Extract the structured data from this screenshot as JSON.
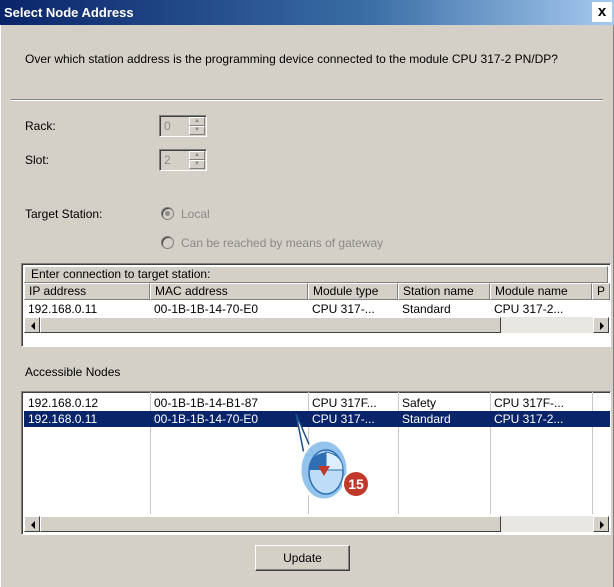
{
  "window": {
    "title": "Select Node Address",
    "close_label": "x"
  },
  "question": "Over which station address is the programming device connected to the module CPU 317-2 PN/DP?",
  "rack": {
    "label": "Rack:",
    "value": "0"
  },
  "slot": {
    "label": "Slot:",
    "value": "2"
  },
  "target_station": {
    "label": "Target Station:",
    "options": [
      "Local",
      "Can be reached by means of gateway"
    ],
    "selected": "Local"
  },
  "connection": {
    "group_label": "Enter connection to target station:",
    "columns": [
      "IP address",
      "MAC address",
      "Module type",
      "Station name",
      "Module name",
      "P"
    ],
    "row": [
      "192.168.0.11",
      "00-1B-1B-14-70-E0",
      "CPU 317-...",
      "Standard",
      "CPU 317-2..."
    ]
  },
  "accessible_nodes": {
    "label": "Accessible Nodes",
    "rows": [
      [
        "192.168.0.12",
        "00-1B-1B-14-B1-87",
        "CPU 317F...",
        "Safety",
        "CPU 317F-..."
      ],
      [
        "192.168.0.11",
        "00-1B-1B-14-70-E0",
        "CPU 317-...",
        "Standard",
        "CPU 317-2..."
      ]
    ],
    "selected_row": 1
  },
  "update_button": "Update",
  "step_badge": "15",
  "colors": {
    "selection": "#0a246a",
    "badge": "#c0392b",
    "dialog": "#d4d0c8"
  }
}
